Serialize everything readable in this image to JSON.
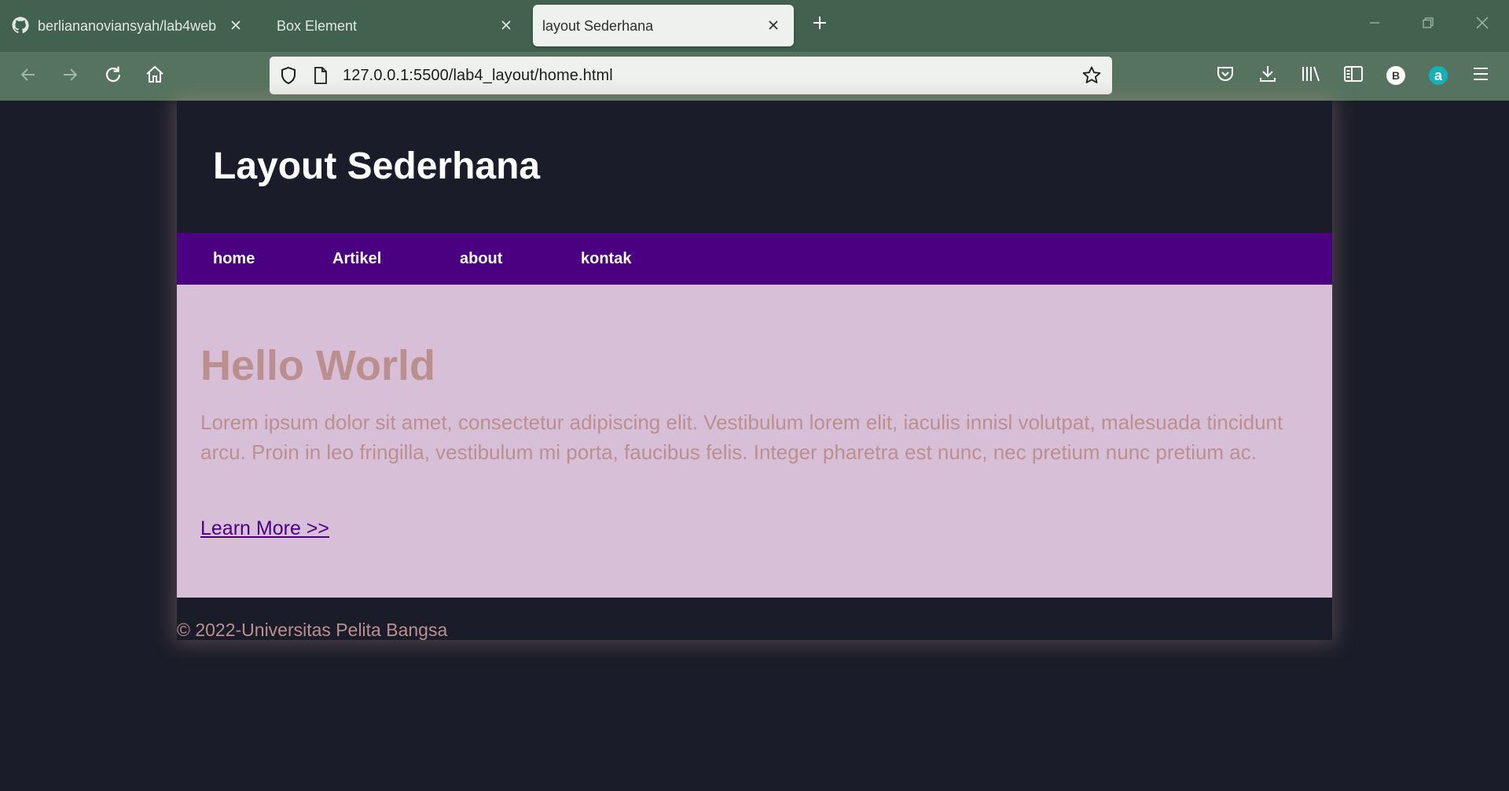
{
  "browser": {
    "tabs": [
      {
        "label": "berliananoviansyah/lab4web",
        "active": false
      },
      {
        "label": "Box Element",
        "active": false
      },
      {
        "label": "layout Sederhana",
        "active": true
      }
    ],
    "url": "127.0.0.1:5500/lab4_layout/home.html",
    "account_initial": "B",
    "addon_initial": "a",
    "colors": {
      "tabbar": "#42614f",
      "toolbar": "#55735e",
      "active_tab": "#eef1ee"
    },
    "icons": {
      "github": "github-icon",
      "close": "close-icon",
      "new_tab": "plus-icon",
      "minimize": "minimize-icon",
      "restore": "restore-icon",
      "window_close": "window-close-icon",
      "back": "back-arrow-icon",
      "forward": "forward-arrow-icon",
      "reload": "reload-icon",
      "home": "home-icon",
      "shield": "shield-icon",
      "page": "page-icon",
      "bookmark": "star-icon",
      "pocket": "pocket-icon",
      "downloads": "download-icon",
      "library": "library-icon",
      "sidebar": "sidebar-icon",
      "menu": "hamburger-menu-icon"
    }
  },
  "page": {
    "site_title": "Layout Sederhana",
    "nav": [
      "home",
      "Artikel",
      "about",
      "kontak"
    ],
    "hero_title": "Hello World",
    "hero_text": "Lorem ipsum dolor sit amet, consectetur adipiscing elit. Vestibulum lorem elit, iaculis innisl volutpat, malesuada tincidunt arcu. Proin in leo fringilla, vestibulum mi porta, faucibus felis. Integer pharetra est nunc, nec pretium nunc pretium ac.",
    "hero_link": "Learn More >>",
    "footer": "© 2022-Universitas Pelita Bangsa",
    "colors": {
      "background": "#1a1d29",
      "nav": "#4b0082",
      "content": "#d8bfd8",
      "text": "#bc8f8f"
    }
  }
}
